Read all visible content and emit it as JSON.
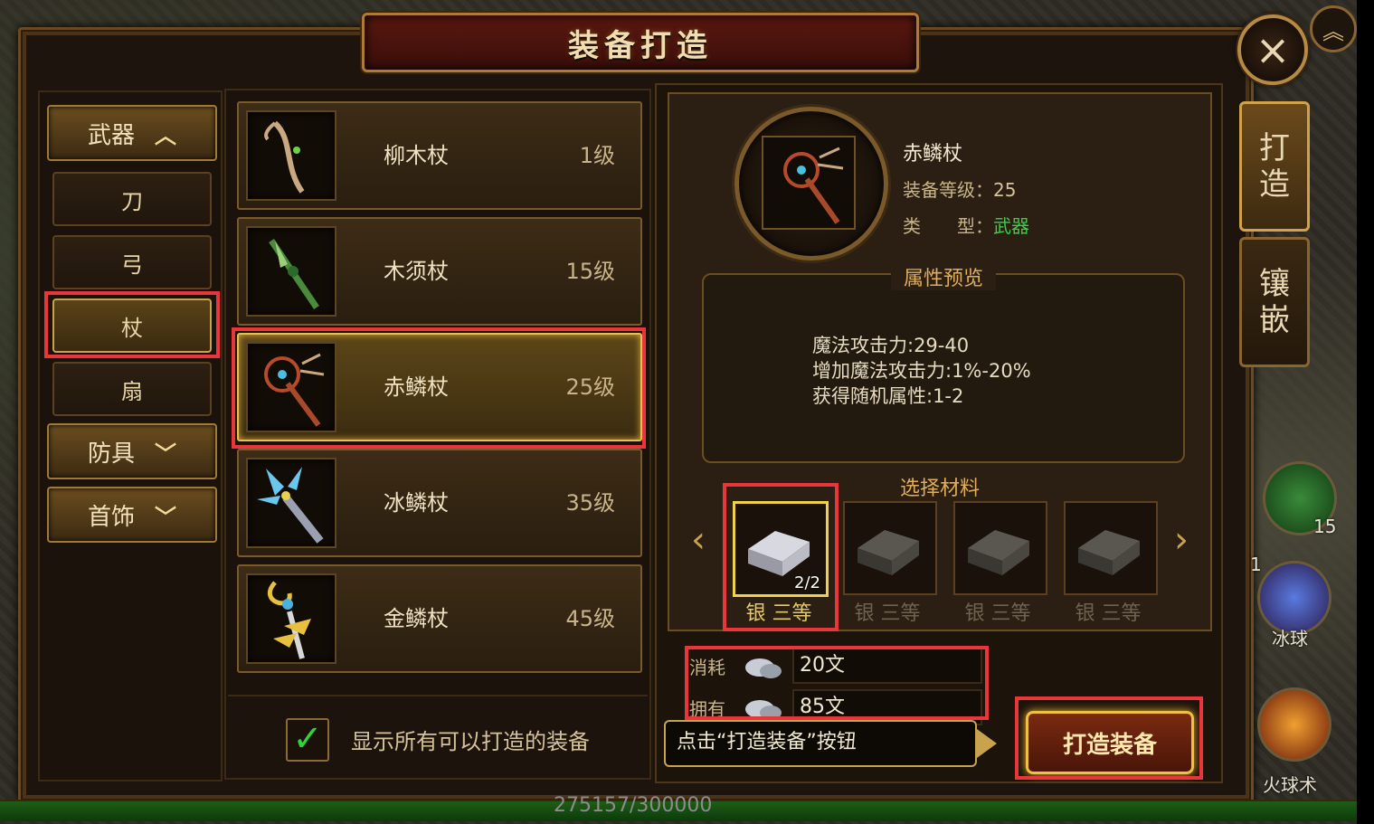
{
  "window": {
    "title": "装备打造",
    "close_icon": "close-icon"
  },
  "categories": {
    "weapon": {
      "label": "武器",
      "expanded": true
    },
    "subs": [
      "刀",
      "弓",
      "杖",
      "扇"
    ],
    "selected_sub": "杖",
    "armor": {
      "label": "防具"
    },
    "jewelry": {
      "label": "首饰"
    }
  },
  "items": [
    {
      "name": "柳木杖",
      "level": "1级"
    },
    {
      "name": "木须杖",
      "level": "15级"
    },
    {
      "name": "赤鳞杖",
      "level": "25级",
      "selected": true
    },
    {
      "name": "冰鳞杖",
      "level": "35级"
    },
    {
      "name": "金鳞杖",
      "level": "45级"
    }
  ],
  "show_all": {
    "checked": true,
    "label": "显示所有可以打造的装备"
  },
  "detail": {
    "name": "赤鳞杖",
    "equip_level_label": "装备等级：",
    "equip_level": "25",
    "type_label": "类　　型：",
    "type_value": "武器",
    "preview_title": "属性预览",
    "attributes": [
      "魔法攻击力:29-40",
      "增加魔法攻击力:1%-20%",
      "获得随机属性:1-2"
    ],
    "materials_title": "选择材料",
    "materials": [
      {
        "label": "银 三等",
        "count": "2/2",
        "selected": true
      },
      {
        "label": "银 三等",
        "count": ""
      },
      {
        "label": "银 三等",
        "count": ""
      },
      {
        "label": "银 三等",
        "count": ""
      }
    ],
    "cost_label": "消耗",
    "cost_value": "20文",
    "own_label": "拥有",
    "own_value": "85文",
    "hint": "点击“打造装备”按钮",
    "forge_button": "打造装备"
  },
  "side_tabs": [
    {
      "label": "打造",
      "active": true
    },
    {
      "label": "镶嵌",
      "active": false
    }
  ],
  "skills": [
    {
      "name": "potion",
      "count": "15"
    },
    {
      "name": "冰球",
      "badge": "1"
    },
    {
      "name": "火球术"
    }
  ],
  "exp_text": "275157/300000",
  "colors": {
    "gold": "#e0ad5a",
    "green": "#37d24a",
    "highlight": "#e8363a"
  }
}
